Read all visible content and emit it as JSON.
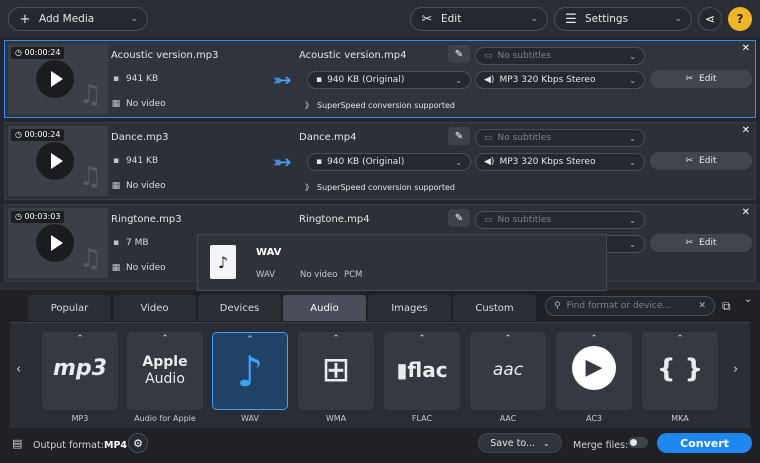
{
  "toolbar": {
    "add_media": "Add Media",
    "edit": "Edit",
    "settings": "Settings",
    "share_icon": "share-icon",
    "help": "?"
  },
  "files": [
    {
      "duration": "00:00:24",
      "source_name": "Acoustic version.mp3",
      "size": "941 KB",
      "video": "No video",
      "output_name": "Acoustic version.mp4",
      "output_size": "940 KB (Original)",
      "subtitles": "No subtitles",
      "audio": "MP3 320 Kbps Stereo",
      "superspeed": "SuperSpeed conversion supported",
      "edit": "Edit"
    },
    {
      "duration": "00:00:24",
      "source_name": "Dance.mp3",
      "size": "941 KB",
      "video": "No video",
      "output_name": "Dance.mp4",
      "output_size": "940 KB (Original)",
      "subtitles": "No subtitles",
      "audio": "MP3 320 Kbps Stereo",
      "superspeed": "SuperSpeed conversion supported",
      "edit": "Edit"
    },
    {
      "duration": "00:03:03",
      "source_name": "Ringtone.mp3",
      "size": "7 MB",
      "video": "No video",
      "output_name": "Ringtone.mp4",
      "subtitles": "No subtitles",
      "edit": "Edit"
    }
  ],
  "tooltip": {
    "title": "WAV",
    "codec_label": "WAV",
    "video": "No video",
    "audio": "PCM"
  },
  "tabs": [
    "Popular",
    "Video",
    "Devices",
    "Audio",
    "Images",
    "Custom"
  ],
  "active_tab": "Audio",
  "search": {
    "placeholder": "Find format or device..."
  },
  "formats": [
    {
      "label": "MP3",
      "logo": "mp3"
    },
    {
      "label": "Audio for Apple",
      "logo": "Apple Audio"
    },
    {
      "label": "WAV",
      "logo": "♪"
    },
    {
      "label": "WMA",
      "logo": "⊞"
    },
    {
      "label": "FLAC",
      "logo": "flac"
    },
    {
      "label": "AAC",
      "logo": "aac"
    },
    {
      "label": "AC3",
      "logo": "▶"
    },
    {
      "label": "MKA",
      "logo": "{ }"
    }
  ],
  "footer": {
    "output_format_label": "Output format:",
    "output_format_value": "MP4",
    "save_to": "Save to...",
    "merge_files": "Merge files:",
    "convert": "Convert"
  },
  "colors": {
    "accent": "#1e88f0",
    "selected_border": "#2e8ef0"
  }
}
